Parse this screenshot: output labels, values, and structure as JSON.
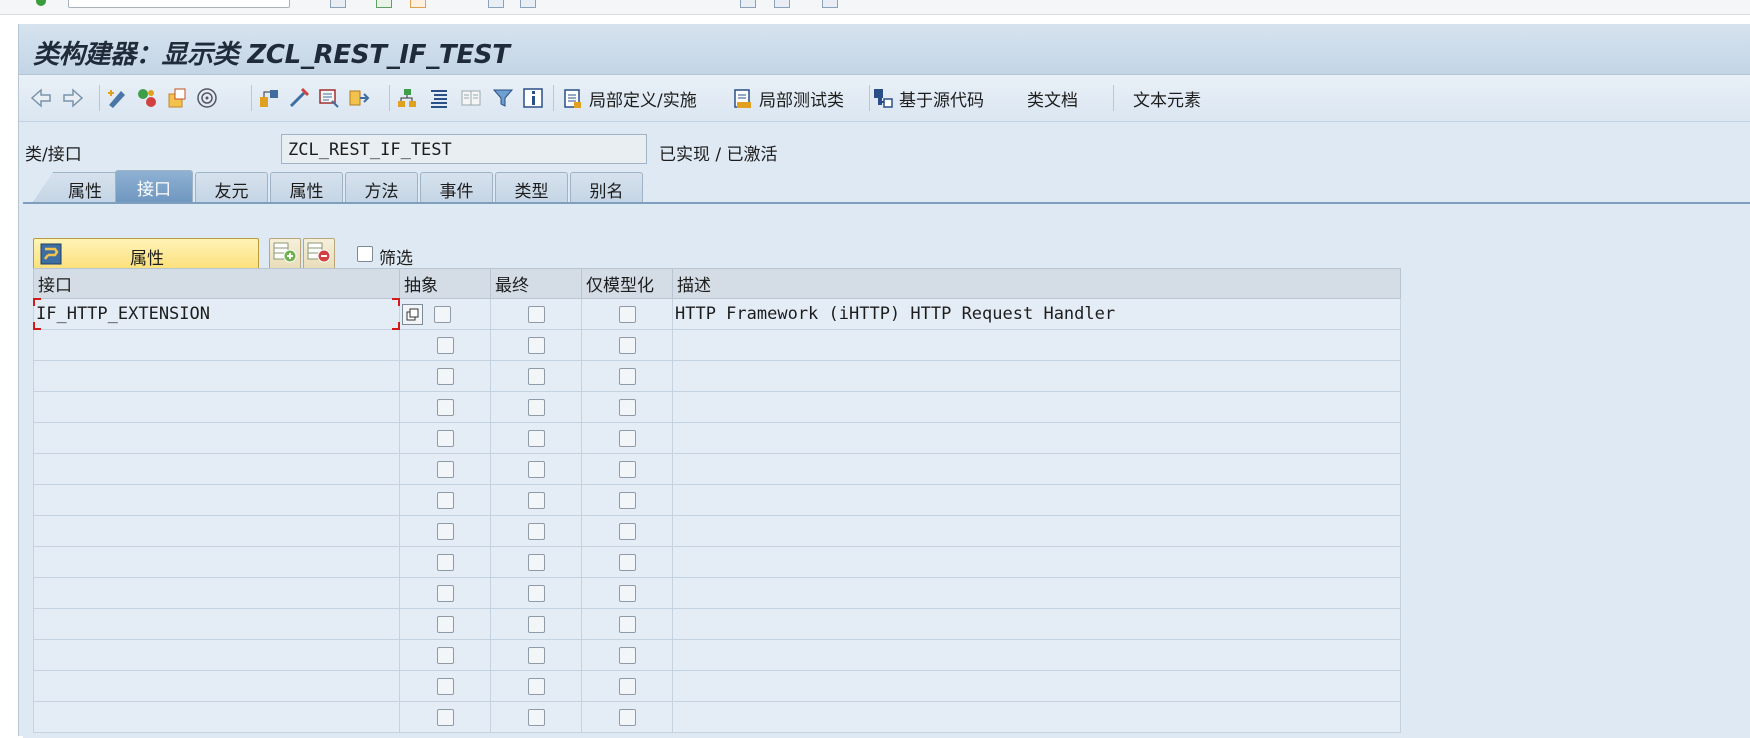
{
  "window": {
    "title": "类构建器：显示类 ZCL_REST_IF_TEST"
  },
  "toolbar": {
    "icons": [
      "back-icon",
      "forward-icon",
      "display-change-icon",
      "check-icon",
      "activate-icon",
      "where-used-icon",
      "object-list-icon",
      "navigation-icon",
      "display-object-icon",
      "enhancement-icon",
      "hierarchy-icon",
      "pretty-printer-icon",
      "documentation-icon",
      "filter-icon",
      "info-icon"
    ],
    "buttons": [
      {
        "label": "局部定义/实施",
        "icon": "local-definitions-icon"
      },
      {
        "label": "局部测试类",
        "icon": "local-test-icon"
      },
      {
        "label": "基于源代码",
        "icon": "source-code-icon"
      },
      {
        "label": "类文档",
        "icon": ""
      },
      {
        "label": "文本元素",
        "icon": ""
      }
    ]
  },
  "header": {
    "class_label": "类/接口",
    "class_value": "ZCL_REST_IF_TEST",
    "status": "已实现 / 已激活"
  },
  "tabs": [
    {
      "label": "属性",
      "active": false
    },
    {
      "label": "接口",
      "active": true
    },
    {
      "label": "友元",
      "active": false
    },
    {
      "label": "属性",
      "active": false
    },
    {
      "label": "方法",
      "active": false
    },
    {
      "label": "事件",
      "active": false
    },
    {
      "label": "类型",
      "active": false
    },
    {
      "label": "别名",
      "active": false
    }
  ],
  "panel": {
    "attributes_button": "属性",
    "filter_label": "筛选"
  },
  "grid": {
    "columns": [
      "接口",
      "抽象",
      "最终",
      "仅模型化",
      "描述"
    ],
    "rows": [
      {
        "interface": "IF_HTTP_EXTENSION",
        "abstract": false,
        "final": false,
        "modeled_only": false,
        "description": "HTTP Framework (iHTTP) HTTP Request Handler"
      }
    ],
    "empty_rows": 13
  },
  "colors": {
    "frame_bg": "#dfe9f3",
    "active_tab": "#7fa4c9",
    "attributes_button": "#fbe07a",
    "selection_corner": "#d21b1b"
  }
}
